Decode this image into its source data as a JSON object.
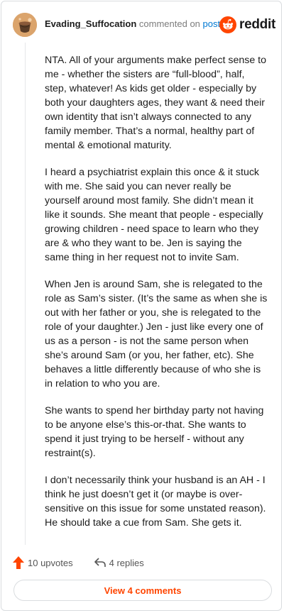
{
  "comment": {
    "username": "Evading_Suffocation",
    "action_text": "commented on",
    "post_link": "post",
    "brand": "reddit",
    "paragraphs": [
      "NTA. All of your arguments make perfect sense to me - whether the sisters are “full-blood”, half, step, whatever! As kids get older - especially by both your daughters ages, they want & need their own identity that isn’t always connected to any family member. That’s a normal, healthy part of mental & emotional maturity.",
      "I heard a psychiatrist explain this once & it stuck with me. She said you can never really be yourself around most family. She didn’t mean it like it sounds. She meant that people - especially growing children - need space to learn who they are & who they want to be. Jen is saying the same thing in her request not to invite Sam.",
      "When Jen is around Sam, she is relegated to the role as Sam’s sister. (It’s the same as when she is out with her father or you, she is relegated to the role of your daughter.) Jen - just like every one of us as a person - is not the same person when she’s around Sam (or you, her father, etc). She behaves a little differently because of who she is in relation to who you are.",
      "She wants to spend her birthday party not having to be anyone else’s this-or-that. She wants to spend it just trying to be herself - without any restraint(s).",
      "I don’t necessarily think your husband is an AH - I think he just doesn’t get it (or maybe is over-sensitive on this issue for some unstated reason). He should take a cue from Sam. She gets it."
    ],
    "upvotes_label": "10 upvotes",
    "replies_label": "4 replies",
    "view_comments_label": "View 4 comments"
  },
  "icons": {
    "upvote": "upvote-arrow-icon",
    "reply": "reply-arrow-icon",
    "brand_logo": "reddit-snoo-icon",
    "avatar": "user-avatar"
  },
  "colors": {
    "accent": "#ff4500",
    "link": "#0079d3",
    "muted": "#7c7c7c",
    "border": "#d9dcdf"
  }
}
